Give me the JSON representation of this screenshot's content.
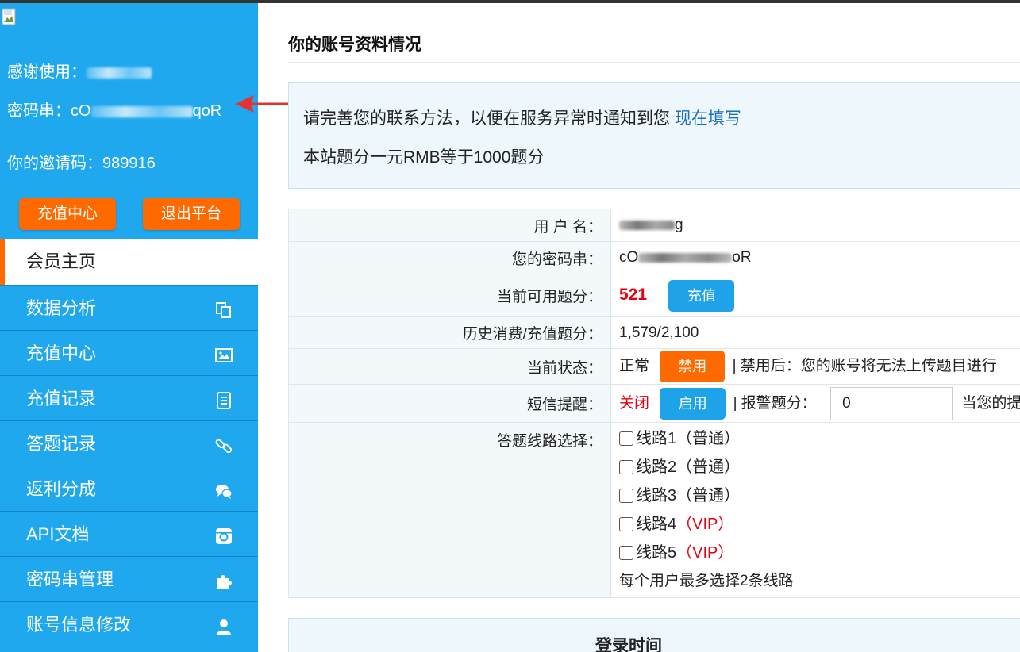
{
  "sidebar": {
    "thanks_label": "感谢使用：",
    "password_label": "密码串：",
    "password_prefix": "cO",
    "password_suffix": "qoR",
    "invite_label": "你的邀请码：",
    "invite_code": "989916",
    "recharge_button": "充值中心",
    "logout_button": "退出平台",
    "menu": [
      {
        "label": "会员主页",
        "icon": "none",
        "active": true
      },
      {
        "label": "数据分析",
        "icon": "copy-icon"
      },
      {
        "label": "充值中心",
        "icon": "image-icon"
      },
      {
        "label": "充值记录",
        "icon": "list-icon"
      },
      {
        "label": "答题记录",
        "icon": "link-icon"
      },
      {
        "label": "返利分成",
        "icon": "chat-icon"
      },
      {
        "label": "API文档",
        "icon": "instagram-icon"
      },
      {
        "label": "密码串管理",
        "icon": "puzzle-icon"
      },
      {
        "label": "账号信息修改",
        "icon": "user-icon"
      }
    ]
  },
  "main": {
    "title": "你的账号资料情况",
    "notice": {
      "line1": "请完善您的联系方法，以便在服务异常时通知到您",
      "line1_link": "现在填写",
      "line2": "本站题分一元RMB等于1000题分"
    },
    "table": {
      "username_label": "用 户 名：",
      "username_suffix": "g",
      "password_label": "您的密码串：",
      "password_prefix": "cO",
      "password_suffix": "oR",
      "points_label": "当前可用题分：",
      "points_value": "521",
      "recharge_button": "充值",
      "history_label": "历史消费/充值题分：",
      "history_value": "1,579/2,100",
      "status_label": "当前状态：",
      "status_value": "正常",
      "disable_button": "禁用",
      "status_note": "| 禁用后：您的账号将无法上传题目进行",
      "sms_label": "短信提醒：",
      "sms_value": "关闭",
      "enable_button": "启用",
      "alarm_label": "| 报警题分：",
      "alarm_value": "0",
      "alarm_note": "当您的提",
      "route_label": "答题线路选择：",
      "routes": [
        {
          "name": "线路1",
          "tag": "（普通）",
          "vip": false
        },
        {
          "name": "线路2",
          "tag": "（普通）",
          "vip": false
        },
        {
          "name": "线路3",
          "tag": "（普通）",
          "vip": false
        },
        {
          "name": "线路4",
          "tag": "（VIP）",
          "vip": true
        },
        {
          "name": "线路5",
          "tag": "（VIP）",
          "vip": true
        }
      ],
      "route_note": "每个用户最多选择2条线路"
    },
    "login_header": "登录时间"
  },
  "colors": {
    "sidebar_bg": "#1fa8ee",
    "accent_orange": "#ff6a00",
    "vip_red": "#e60012",
    "link_blue": "#1f6fc0"
  }
}
